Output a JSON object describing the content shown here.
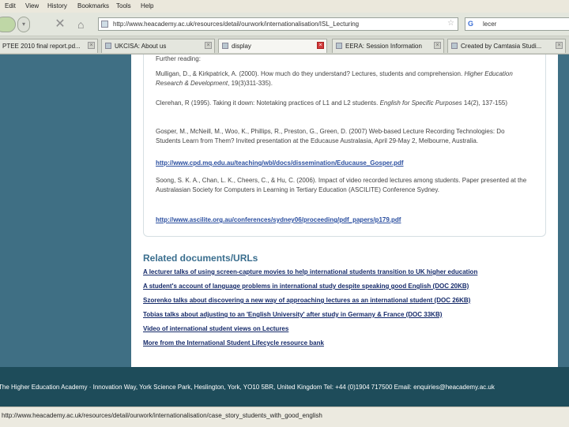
{
  "menu": {
    "edit": "Edit",
    "view": "View",
    "history": "History",
    "bookmarks": "Bookmarks",
    "tools": "Tools",
    "help": "Help"
  },
  "nav": {
    "url": "http://www.heacademy.ac.uk/resources/detail/ourwork/internationalisation/ISL_Lecturing",
    "search_text": "lecer",
    "search_engine": "G"
  },
  "tabs": [
    {
      "label": "PTEE 2010 final report.pd..."
    },
    {
      "label": "UKCISA: About us"
    },
    {
      "label": "display"
    },
    {
      "label": "EERA: Session Information"
    },
    {
      "label": "Created by Camtasia Studi..."
    }
  ],
  "references": {
    "further_reading": "Further reading:",
    "items": [
      {
        "text": "Mulligan, D., & Kirkpatrick, A. (2000). How much do they understand? Lectures, students and comprehension. ",
        "italic": "Higher Education Research & Development",
        "tail": ", 19(3)311-335)."
      },
      {
        "text": "Clerehan, R (1995). Taking it down: Notetaking practices of L1 and L2 students. ",
        "italic": "English for Specific Purposes",
        "tail": " 14(2), 137-155)"
      },
      {
        "text": "Gosper, M., McNeill, M., Woo, K., Phillips, R., Preston, G., Green, D. (2007) Web-based Lecture Recording Technologies: Do Students Learn from Them? Invited presentation at the Educause Australasia, April 29-May 2, Melbourne, Australia.",
        "italic": "",
        "tail": ""
      },
      {
        "text": "Soong, S. K. A., Chan, L. K., Cheers, C., & Hu, C. (2006). Impact of video recorded lectures among students. Paper presented at the Australasian Society for Computers in Learning in Tertiary Education (ASCILITE) Conference Sydney.",
        "italic": "",
        "tail": ""
      }
    ],
    "link1": "http://www.cpd.mq.edu.au/teaching/wbl/docs/dissemination/Educause_Gosper.pdf",
    "link2": "http://www.ascilite.org.au/conferences/sydney06/proceeding/pdf_papers/p179.pdf"
  },
  "related": {
    "title": "Related documents/URLs",
    "links": [
      "A lecturer talks of using screen-capture movies to help international students transition to UK higher education",
      "A student's account of language problems in international study despite speaking good English (DOC 20KB)",
      "Szorenko talks about discovering a new way of approaching lectures as an international student (DOC 26KB)",
      "Tobias talks about adjusting to an 'English University' after study in Germany & France (DOC 33KB)",
      "Video of international student views on Lectures",
      "More from the International Student Lifecycle resource bank"
    ]
  },
  "footer": "The Higher Education Academy · Innovation Way, York Science Park, Heslington, York, YO10 5BR, United Kingdom  Tel: +44 (0)1904 717500  Email: enquiries@heacademy.ac.uk",
  "status": "http://www.heacademy.ac.uk/resources/detail/ourwork/internationalisation/case_story_students_with_good_english"
}
